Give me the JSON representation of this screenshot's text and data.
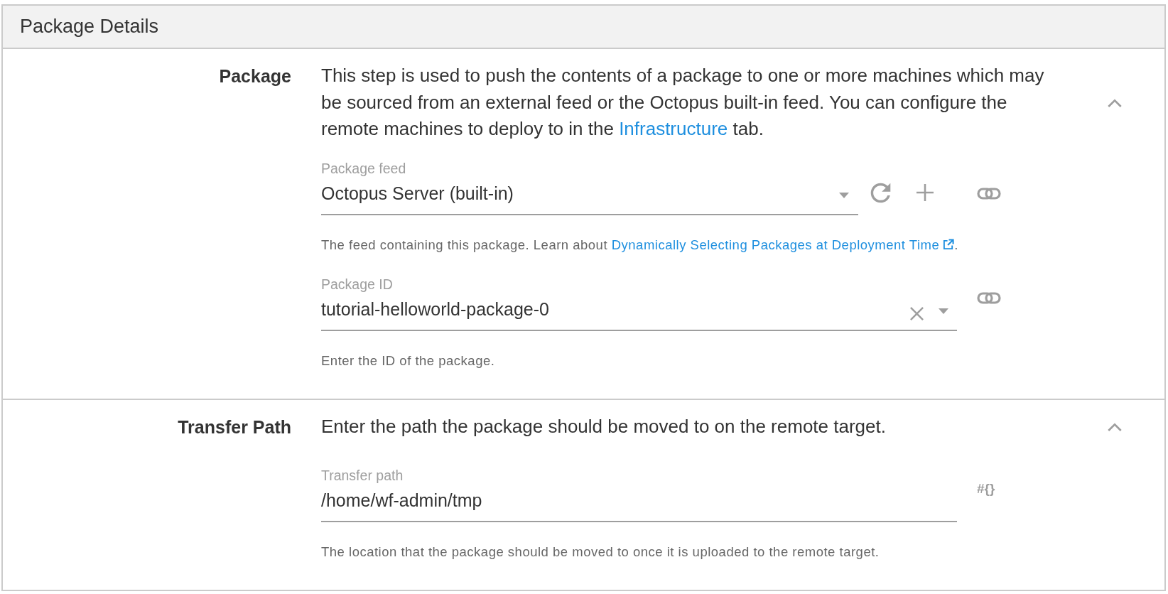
{
  "panel": {
    "title": "Package Details"
  },
  "sections": [
    {
      "label": "Package",
      "expanded": true,
      "description": {
        "text": "This step is used to push the contents of a package to one or more machines which may be sourced from an external feed or the Octopus built-in feed. You can configure the remote machines to deploy to in the ",
        "link": "Infrastructure",
        "after": " tab."
      },
      "fields": [
        {
          "kind": "select",
          "label": "Package feed",
          "value": "Octopus Server (built-in)",
          "helper": {
            "text": "The feed containing this package. Learn about ",
            "link": "Dynamically Selecting Packages at Deployment Time",
            "external": true,
            "after": "."
          }
        },
        {
          "kind": "combobox",
          "label": "Package ID",
          "value": "tutorial-helloworld-package-0",
          "helper": {
            "text": "Enter the ID of the package."
          }
        }
      ]
    },
    {
      "label": "Transfer Path",
      "expanded": true,
      "description": {
        "text": "Enter the path the package should be moved to on the remote target."
      },
      "fields": [
        {
          "kind": "text",
          "label": "Transfer path",
          "value": "/home/wf-admin/tmp",
          "bind_toggle": "#{}",
          "helper": {
            "text": "The location that the package should be moved to once it is uploaded to the remote target."
          }
        }
      ]
    }
  ]
}
